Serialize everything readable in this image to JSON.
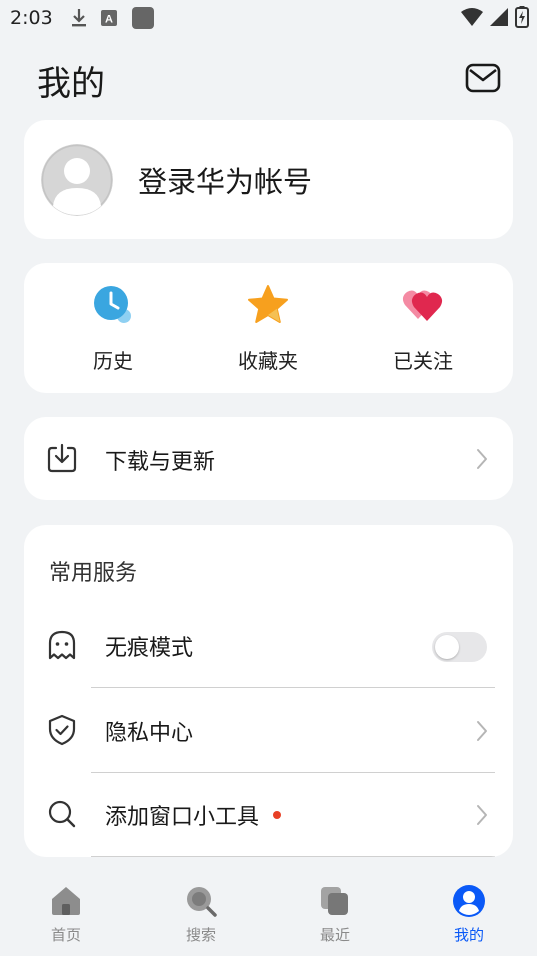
{
  "status_bar": {
    "time": "2:03"
  },
  "header": {
    "title": "我的"
  },
  "login": {
    "label": "登录华为帐号"
  },
  "shortcuts": [
    {
      "label": "历史",
      "icon": "history-clock-icon"
    },
    {
      "label": "收藏夹",
      "icon": "favorites-star-icon"
    },
    {
      "label": "已关注",
      "icon": "followed-heart-icon"
    }
  ],
  "download": {
    "label": "下载与更新"
  },
  "services": {
    "title": "常用服务",
    "items": [
      {
        "label": "无痕模式",
        "icon": "ghost-icon",
        "control": "toggle",
        "toggle_on": false
      },
      {
        "label": "隐私中心",
        "icon": "shield-check-icon",
        "control": "chevron"
      },
      {
        "label": "添加窗口小工具",
        "icon": "search-icon",
        "control": "chevron",
        "badge": "red-dot"
      }
    ]
  },
  "bottom_nav": [
    {
      "label": "首页",
      "icon": "home-icon",
      "active": false
    },
    {
      "label": "搜索",
      "icon": "search-icon",
      "active": false
    },
    {
      "label": "最近",
      "icon": "recent-cards-icon",
      "active": false
    },
    {
      "label": "我的",
      "icon": "profile-icon",
      "active": true
    }
  ],
  "colors": {
    "background": "#f1f3f5",
    "card": "#ffffff",
    "accent_blue": "#0a59f7",
    "badge_red": "#e84026"
  }
}
